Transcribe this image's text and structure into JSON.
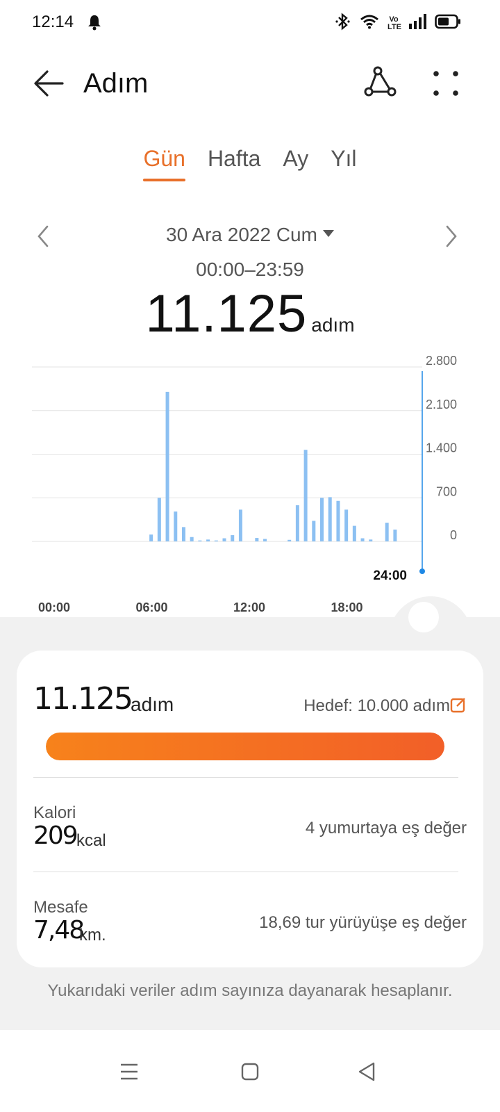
{
  "status_bar": {
    "time": "12:14",
    "icons": [
      "bell-icon",
      "bluetooth-icon",
      "wifi-icon",
      "volte-icon",
      "signal-icon",
      "battery-icon"
    ],
    "volte_text": "Vo LTE"
  },
  "app_bar": {
    "title": "Adım",
    "icons": [
      "back-arrow-icon",
      "share-route-icon",
      "more-dots-icon"
    ]
  },
  "tabs": [
    {
      "label": "Gün",
      "active": true
    },
    {
      "label": "Hafta",
      "active": false
    },
    {
      "label": "Ay",
      "active": false
    },
    {
      "label": "Yıl",
      "active": false
    }
  ],
  "date_nav": {
    "date": "30 Ara 2022 Cum",
    "time_range": "00:00–23:59"
  },
  "summary": {
    "total": "11.125",
    "unit": "adım"
  },
  "chart_data": {
    "type": "bar",
    "ytick_labels": [
      "2.800",
      "2.100",
      "1.400",
      "700",
      "0"
    ],
    "ylim": [
      0,
      2800
    ],
    "xtick_labels": [
      "00:00",
      "06:00",
      "12:00",
      "18:00"
    ],
    "xlim": [
      0,
      24
    ],
    "x": [
      7.33,
      7.83,
      8.33,
      8.83,
      9.33,
      9.83,
      10.33,
      10.83,
      11.33,
      11.83,
      12.33,
      12.83,
      13.83,
      14.33,
      15.83,
      16.33,
      16.83,
      17.33,
      17.83,
      18.33,
      18.83,
      19.33,
      19.83,
      20.33,
      20.83,
      21.83,
      22.33
    ],
    "values": [
      110,
      700,
      2400,
      480,
      230,
      70,
      15,
      30,
      15,
      50,
      100,
      510,
      55,
      40,
      25,
      580,
      1470,
      330,
      700,
      710,
      650,
      510,
      250,
      50,
      30,
      300,
      190
    ],
    "current_marker": "24:00",
    "color": "#8cc0f2",
    "grid": true
  },
  "card": {
    "steps": "11.125",
    "steps_unit": "adım",
    "goal": "Hedef: 10.000 adım",
    "progress": 1.0,
    "calories_label": "Kalori",
    "calories_value": "209",
    "calories_unit": "kcal",
    "calories_eq": "4 yumurtaya eş değer",
    "distance_label": "Mesafe",
    "distance_value": "7,48",
    "distance_unit": "km.",
    "distance_eq": "18,69 tur yürüyüşe eş değer"
  },
  "footnote": "Yukarıdaki veriler adım sayınıza dayanarak hesaplanır.",
  "colors": {
    "accent": "#e8702a",
    "bar": "#8cc0f2",
    "marker": "#1e88e5"
  }
}
